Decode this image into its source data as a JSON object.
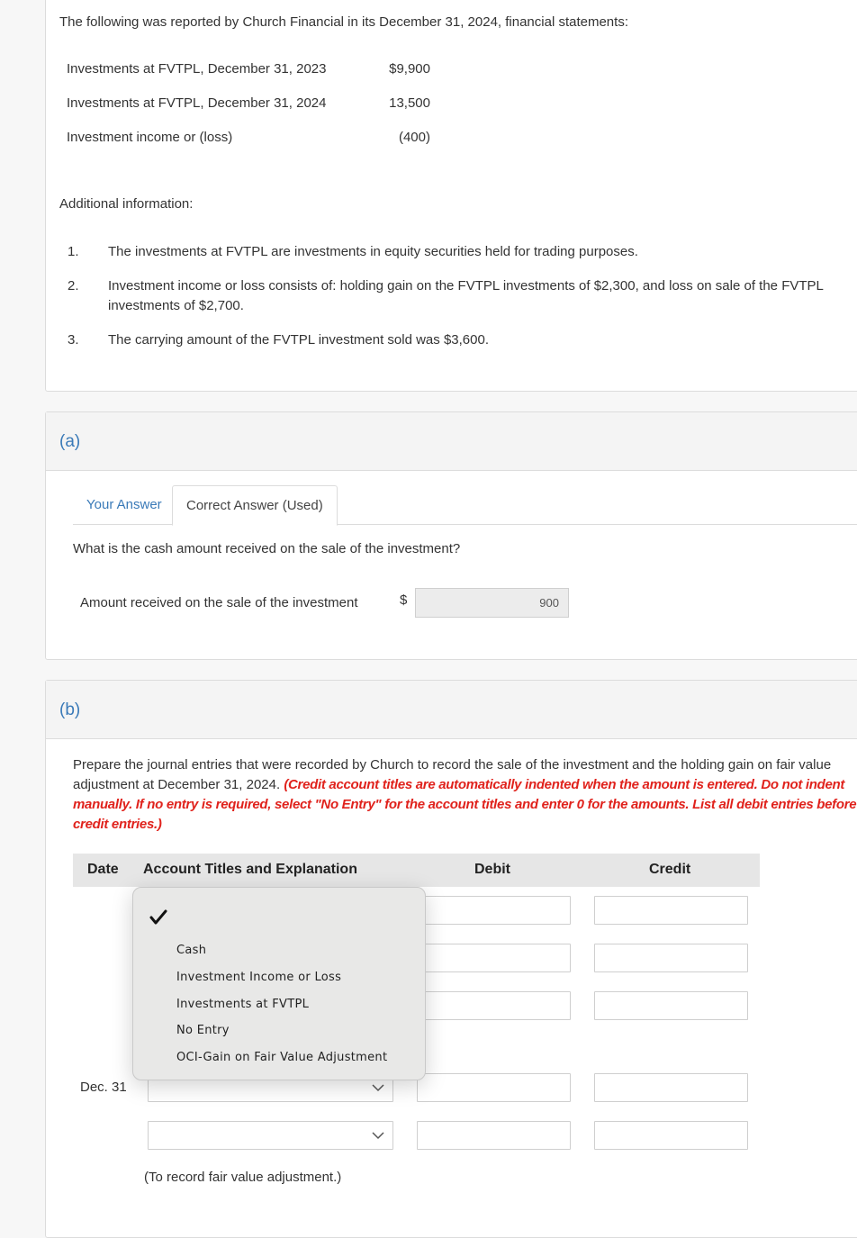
{
  "intro": {
    "text": "The following was reported by Church Financial in its December 31, 2024, financial statements:",
    "financials": [
      {
        "label": "Investments at FVTPL, December 31, 2023",
        "value": "$9,900"
      },
      {
        "label": "Investments at FVTPL, December 31, 2024",
        "value": "13,500"
      },
      {
        "label": "Investment income or (loss)",
        "value": "(400)"
      }
    ],
    "additional_label": "Additional information:",
    "additional_items": [
      {
        "num": "1.",
        "text": "The investments at FVTPL are investments in equity securities held for trading purposes."
      },
      {
        "num": "2.",
        "text": "Investment income or loss consists of: holding gain on the FVTPL investments of $2,300, and loss on sale of the FVTPL investments of $2,700."
      },
      {
        "num": "3.",
        "text": "The carrying amount of the FVTPL investment sold was $3,600."
      }
    ]
  },
  "part_a": {
    "letter": "(a)",
    "tabs": [
      {
        "label": "Your Answer",
        "active": false
      },
      {
        "label": "Correct Answer (Used)",
        "active": true
      }
    ],
    "question": "What is the cash amount received on the sale of the investment?",
    "amount_label": "Amount received on the sale of the investment",
    "currency": "$",
    "amount_value": "900"
  },
  "part_b": {
    "letter": "(b)",
    "instruction": "Prepare the journal entries that were recorded by Church to record the sale of the investment and the holding gain on fair value adjustment at December 31, 2024.",
    "instruction_red": "(Credit account titles are automatically indented when the amount is entered. Do not indent manually. If no entry is required, select \"No Entry\" for the account titles and enter 0 for the amounts. List all debit entries before credit entries.)",
    "headers": {
      "date": "Date",
      "account": "Account Titles and Explanation",
      "debit": "Debit",
      "credit": "Credit"
    },
    "rows": [
      {
        "date": "",
        "account": "",
        "debit": "",
        "credit": ""
      },
      {
        "date": "",
        "account": "",
        "debit": "",
        "credit": ""
      },
      {
        "date": "",
        "account": "",
        "debit": "",
        "credit": ""
      },
      {
        "date": "Dec. 31",
        "account": "",
        "debit": "",
        "credit": ""
      },
      {
        "date": "",
        "account": "",
        "debit": "",
        "credit": ""
      }
    ],
    "note": "(To record fair value adjustment.)",
    "dropdown": {
      "selected": "",
      "options": [
        "Cash",
        "Investment Income or Loss",
        "Investments at FVTPL",
        "No Entry",
        "OCI-Gain on Fair Value Adjustment"
      ]
    }
  }
}
